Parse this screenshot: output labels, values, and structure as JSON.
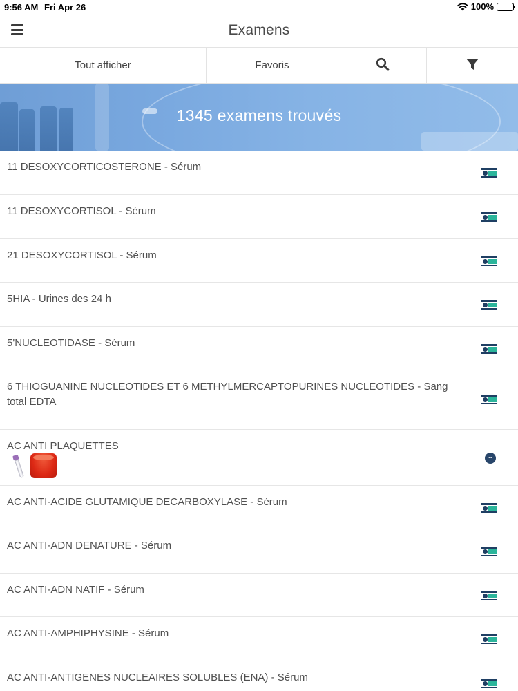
{
  "status_bar": {
    "time": "9:56 AM",
    "date": "Fri Apr 26",
    "battery": "100%",
    "wifi_icon": "wifi-icon",
    "battery_icon": "battery-full-icon"
  },
  "nav": {
    "title": "Examens",
    "menu_icon": "hamburger-menu-icon"
  },
  "tabs": {
    "all_label": "Tout afficher",
    "favorites_label": "Favoris",
    "search_icon": "search-icon",
    "filter_icon": "filter-icon"
  },
  "banner": {
    "count_text": "1345 examens trouvés"
  },
  "colors": {
    "banner_blue": "#79a8df",
    "tube_dark": "#1f3f63",
    "tube_green": "#2bb59b",
    "text": "#505050",
    "divider": "#e6e6e6"
  },
  "exams": [
    {
      "name": "11 DESOXYCORTICOSTERONE - Sérum",
      "icon": "serum-tube-icon"
    },
    {
      "name": "11 DESOXYCORTISOL - Sérum",
      "icon": "serum-tube-icon"
    },
    {
      "name": "21 DESOXYCORTISOL - Sérum",
      "icon": "serum-tube-icon"
    },
    {
      "name": "5HIA - Urines des 24 h",
      "icon": "serum-tube-icon"
    },
    {
      "name": "5'NUCLEOTIDASE - Sérum",
      "icon": "serum-tube-icon"
    },
    {
      "name": "6 THIOGUANINE NUCLEOTIDES ET 6 METHYLMERCAPTOPURINES NUCLEOTIDES - Sang total EDTA",
      "icon": "serum-tube-icon"
    },
    {
      "name": "AC ANTI PLAQUETTES",
      "icon": "info-badge-icon"
    },
    {
      "name": "AC ANTI-ACIDE GLUTAMIQUE DECARBOXYLASE - Sérum",
      "icon": "serum-tube-icon"
    },
    {
      "name": "AC ANTI-ADN DENATURE - Sérum",
      "icon": "serum-tube-icon"
    },
    {
      "name": "AC ANTI-ADN NATIF - Sérum",
      "icon": "serum-tube-icon"
    },
    {
      "name": "AC ANTI-AMPHIPHYSINE - Sérum",
      "icon": "serum-tube-icon"
    },
    {
      "name": "AC ANTI-ANTIGENES NUCLEAIRES SOLUBLES (ENA) - Sérum",
      "icon": "serum-tube-icon"
    }
  ]
}
